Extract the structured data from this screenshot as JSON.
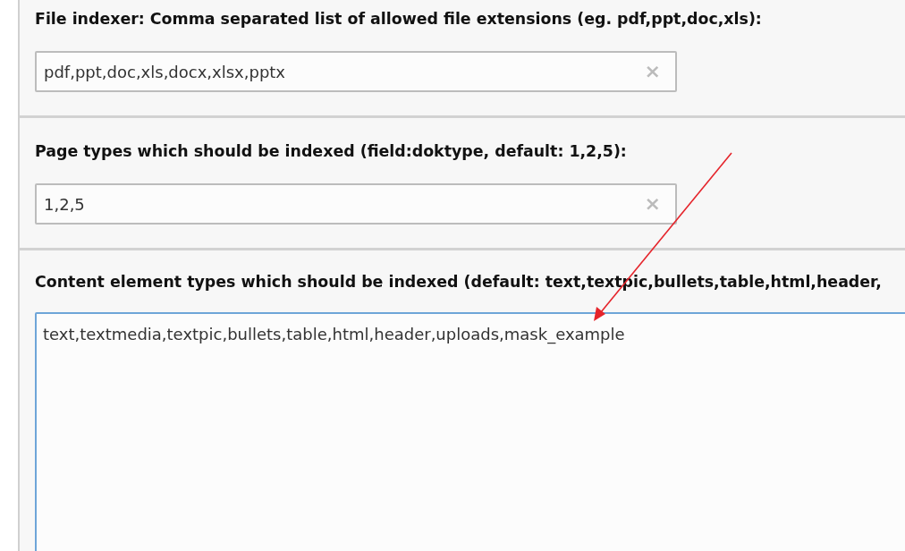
{
  "sections": [
    {
      "kind": "input",
      "label": "File indexer: Comma separated list of allowed file extensions (eg. pdf,ppt,doc,xls):",
      "value": "pdf,ppt,doc,xls,docx,xlsx,pptx",
      "clear": "×"
    },
    {
      "kind": "input",
      "label": "Page types which should be indexed (field:doktype, default: 1,2,5):",
      "value": "1,2,5",
      "clear": "×"
    },
    {
      "kind": "textarea",
      "label": "Content element types which should be indexed (default: text,textpic,bullets,table,html,header,",
      "value": "text,textmedia,textpic,bullets,table,html,header,uploads,mask_example"
    }
  ]
}
